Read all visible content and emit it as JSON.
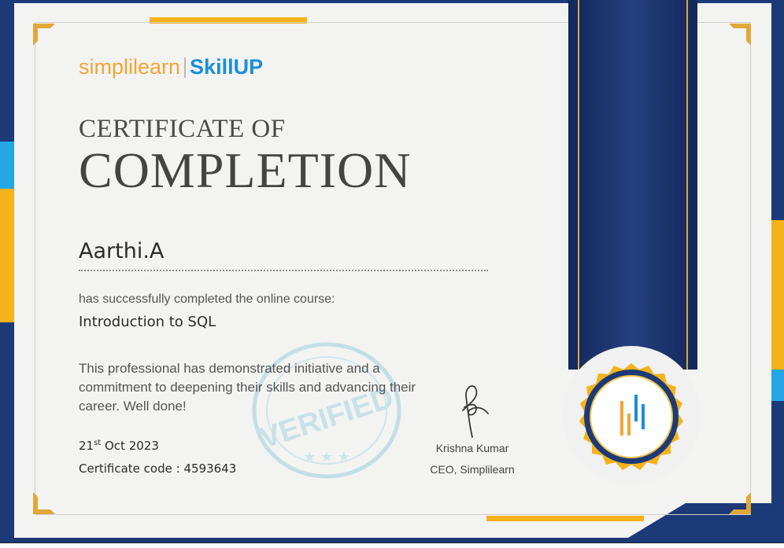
{
  "brand": {
    "part1": "simplilearn",
    "part2": "SkillUP"
  },
  "certificate": {
    "title_line1": "CERTIFICATE OF",
    "title_line2": "COMPLETION",
    "recipient": "Aarthi.A",
    "completed_text": "has successfully completed the online course:",
    "course": "Introduction to SQL",
    "description": "This professional has demonstrated initiative and a commitment to deepening their skills and advancing their career. Well done!",
    "date_day": "21",
    "date_suffix": "st",
    "date_rest": " Oct 2023",
    "code_label": "Certificate code : ",
    "code_value": "4593643"
  },
  "signatory": {
    "name": "Krishna Kumar",
    "title": "CEO, Simplilearn"
  },
  "stamp": {
    "text": "VERIFIED"
  },
  "colors": {
    "navy": "#1c3a78",
    "gold": "#f5b21b",
    "cyan": "#25a7e6",
    "paper": "#f3f3f2",
    "brand_orange": "#f1a534",
    "brand_blue": "#1b8fd8"
  }
}
